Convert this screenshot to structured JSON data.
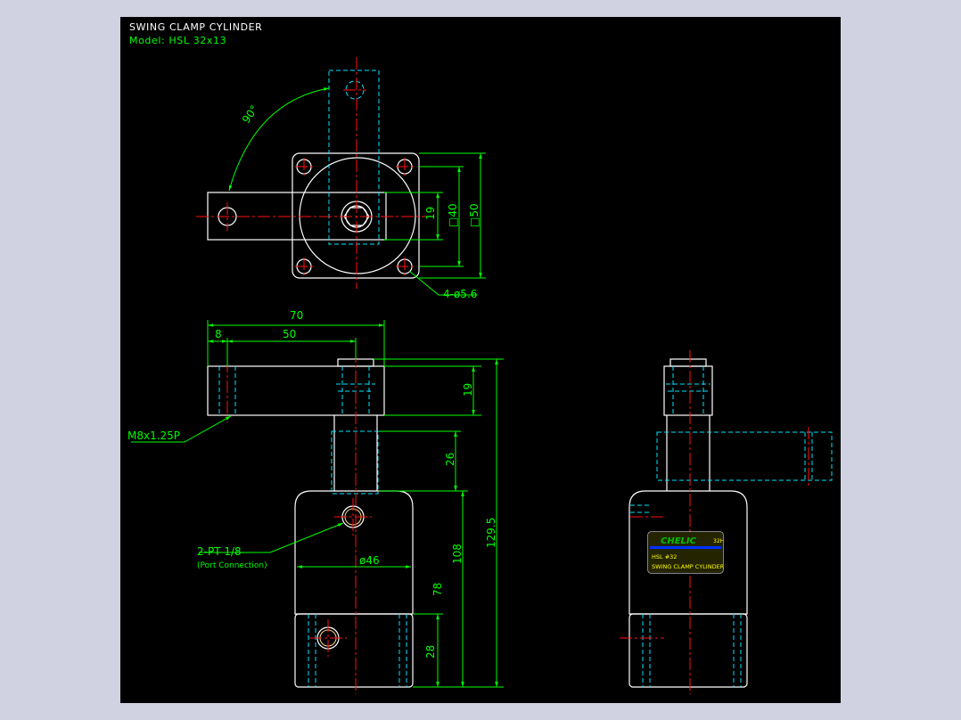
{
  "title": "SWING CLAMP CYLINDER",
  "model": "Model: HSL 32x13",
  "dimensions": {
    "angle": "90°",
    "d19_top": "19",
    "sq40": "□40",
    "sq50": "□50",
    "holes": "4-ø5.6",
    "d70": "70",
    "d8": "8",
    "d50": "50",
    "d19": "19",
    "d26": "26",
    "d1295": "129.5",
    "d108": "108",
    "d78": "78",
    "d28": "28",
    "dia46": "ø46",
    "thread": "M8x1.25P",
    "port": "2-PT 1/8",
    "port_note": "(Port Connection)"
  },
  "label": {
    "brand": "CHELIC",
    "tag": "32H",
    "model": "HSL #32",
    "name": "SWING CLAMP CYLINDER"
  },
  "colors": {
    "background": "#000000",
    "outline": "#ffffff",
    "hidden": "#00e5ff",
    "center": "#ff1010",
    "dimension": "#00ff00",
    "title": "#ffffff",
    "model": "#00ff00",
    "label_bg": "#ffff00",
    "label_brand": "#00a000",
    "label_stripe": "#0030ff"
  }
}
